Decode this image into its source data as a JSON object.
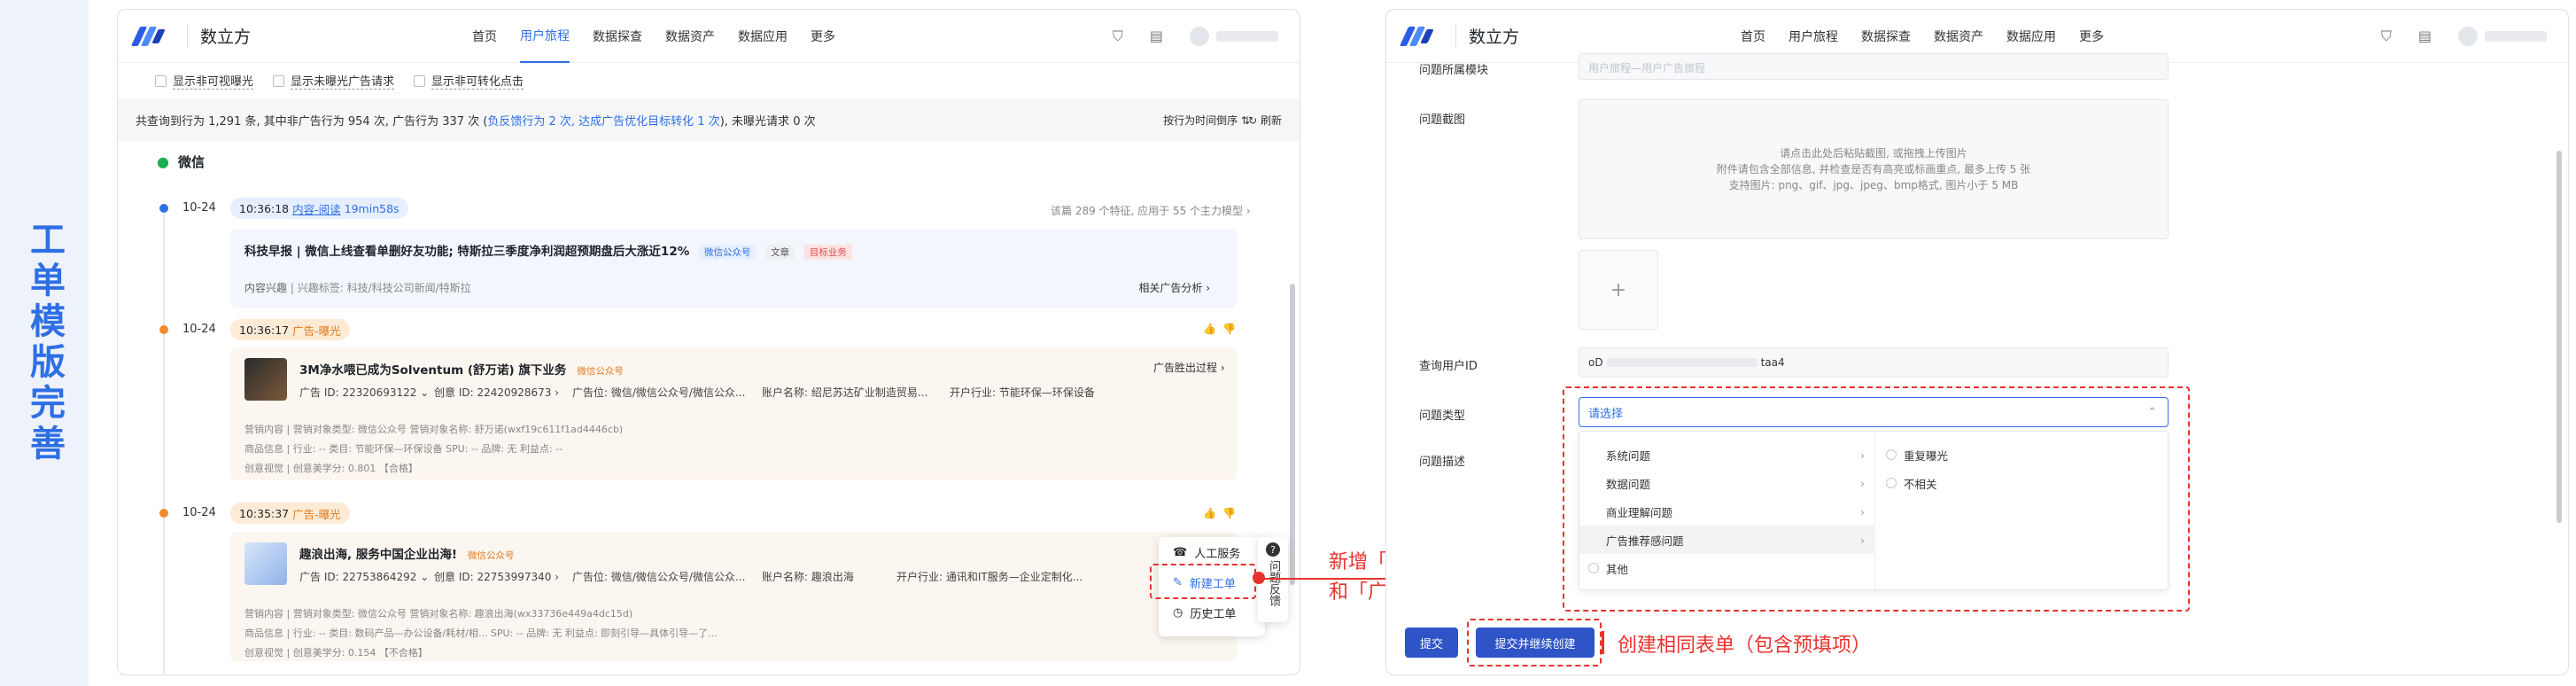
{
  "side_label": "工单模版完善",
  "brand": "数立方",
  "nav": [
    "首页",
    "用户旅程",
    "数据探查",
    "数据资产",
    "数据应用",
    "更多"
  ],
  "left": {
    "filters": [
      "显示非可视曝光",
      "显示未曝光广告请求",
      "显示非可转化点击"
    ],
    "summary_a": "共查询到行为 1,291 条, 其中非广告行为 954 次, 广告行为 337 次 (",
    "summary_link": "负反馈行为 2 次, 达成广告优化目标转化 1 次",
    "summary_b": "), 未曝光请求 0 次",
    "sort": "按行为时间倒序 ⇅",
    "refresh": "↻ 刷新",
    "wechat": "微信",
    "event1": {
      "date": "10-24",
      "time": "10:36:18",
      "kind": "内容-阅读",
      "dur": "19min58s",
      "right": "该篇 289 个特征, 应用于 55 个主力模型 ›",
      "title": "科技早报 | 微信上线查看单删好友功能; 特斯拉三季度净利润超预期盘后大涨近12%",
      "pill1": "微信公众号",
      "pill2": "文章",
      "pill3": "目标业务",
      "interest": "内容兴趣",
      "interest_val": "兴趣标签: 科技/科技公司新闻/特斯拉",
      "analysis": "相关广告分析 ›"
    },
    "event2": {
      "date": "10-24",
      "time": "10:36:17",
      "kind": "广告-曝光",
      "title": "3M净水喂已成为Solventum (舒万诺) 旗下业务",
      "pill": "微信公众号",
      "ad_id": "广告 ID: 22320693122 ⌄",
      "creative": "创意 ID: 22420928673 ›",
      "pos": "广告位: 微信/微信公众号/微信公众...",
      "account": "账户名称: 绍尼苏达矿业制造贸易...",
      "industry": "开户行业: 节能环保—环保设备",
      "process": "广告胜出过程 ›",
      "m1": "营销内容 | 营销对象类型: 微信公众号    营销对象名称: 舒万诺(wxf19c611f1ad4446cb)",
      "m2": "商品信息 | 行业: --    类目: 节能环保—环保设备    SPU: --    品牌: 无    利益点: --",
      "m3": "创意视觉 | 创意美学分: 0.801 【合格】"
    },
    "event3": {
      "date": "10-24",
      "time": "10:35:37",
      "kind": "广告-曝光",
      "title": "趣浪出海, 服务中国企业出海!",
      "pill": "微信公众号",
      "ad_id": "广告 ID: 22753864292 ⌄",
      "creative": "创意 ID: 22753997340 ›",
      "pos": "广告位: 微信/微信公众号/微信公众...",
      "account": "账户名称: 趣浪出海",
      "industry": "开户行业: 通讯和IT服务—企业定制化...",
      "m1": "营销内容 | 营销对象类型: 微信公众号    营销对象名称: 趣浪出海(wx33736e449a4dc15d)",
      "m2": "商品信息 | 行业: --    类目: 数码产品—办公设备/耗材/相...    SPU: --    品牌: 无    利益点: 即刻引导—具体引导—了...",
      "m3": "创意视觉 | 创意美学分: 0.154 【不合格】"
    },
    "menu": [
      "人工服务",
      "新建工单",
      "历史工单"
    ],
    "feedback": "问题反馈"
  },
  "annotation1": [
    "新增「特征问题」",
    "和「广告推荐感问题」"
  ],
  "annotation2": "创建相同表单（包含预填项）",
  "right": {
    "module_label": "问题所属模块",
    "module_value": "用户旅程—用户广告旅程",
    "shot_label": "问题截图",
    "upload_lines": [
      "请点击此处后粘贴截图, 或拖拽上传图片",
      "附件请包含全部信息, 并检查是否有高亮或标画重点, 最多上传 5 张",
      "支持图片: png、gif、jpg、jpeg、bmp格式, 图片小于 5 MB"
    ],
    "plus": "+",
    "openid_label": "查询用户ID",
    "openid_prefix": "oD",
    "openid_suffix": "taa4",
    "type_label": "问题类型",
    "type_placeholder": "请选择",
    "desc_label": "问题描述",
    "options": [
      "系统问题",
      "数据问题",
      "商业理解问题",
      "广告推荐感问题",
      "其他"
    ],
    "sub_options": [
      "重复曝光",
      "不相关"
    ],
    "submit": "提交",
    "submit_continue": "提交并继续创建"
  }
}
